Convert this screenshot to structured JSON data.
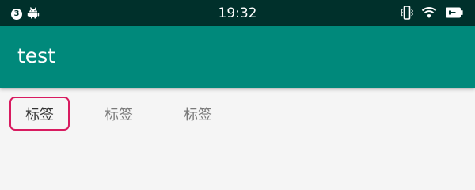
{
  "status_bar": {
    "notification_count": "3",
    "time": "19:32",
    "icons": [
      "notification-count-badge",
      "android-icon",
      "vibrate-icon",
      "wifi-icon",
      "battery-icon"
    ]
  },
  "app_bar": {
    "title": "test",
    "color": "#00897b"
  },
  "tabs": [
    {
      "label": "标签",
      "selected": true
    },
    {
      "label": "标签",
      "selected": false
    },
    {
      "label": "标签",
      "selected": false
    }
  ],
  "colors": {
    "status_bar": "#00302b",
    "selected_tab_border": "#d81b60",
    "background": "#f5f5f5"
  }
}
